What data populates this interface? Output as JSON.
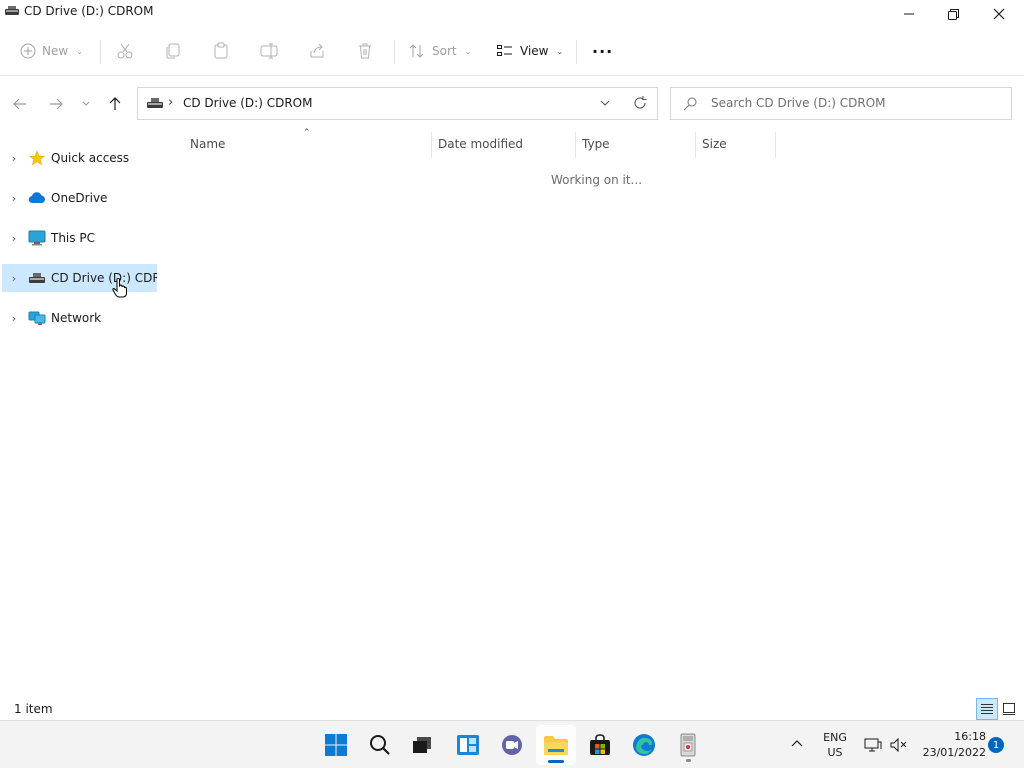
{
  "window": {
    "title": "CD Drive (D:) CDROM"
  },
  "commandbar": {
    "new_label": "New",
    "sort_label": "Sort",
    "view_label": "View",
    "more_label": "···"
  },
  "address": {
    "path": "CD Drive (D:) CDROM",
    "separator": "›"
  },
  "search": {
    "placeholder": "Search CD Drive (D:) CDROM"
  },
  "sidebar": {
    "items": [
      {
        "label": "Quick access",
        "icon": "star-icon"
      },
      {
        "label": "OneDrive",
        "icon": "cloud-icon"
      },
      {
        "label": "This PC",
        "icon": "monitor-icon"
      },
      {
        "label": "CD Drive (D:) CDROM",
        "icon": "cd-drive-icon",
        "selected": true
      },
      {
        "label": "Network",
        "icon": "network-icon"
      }
    ]
  },
  "columns": {
    "name": "Name",
    "date_modified": "Date modified",
    "type": "Type",
    "size": "Size"
  },
  "content": {
    "status_message": "Working on it..."
  },
  "statusbar": {
    "item_count": "1 item"
  },
  "taskbar": {
    "language": "ENG",
    "region": "US",
    "time": "16:18",
    "date": "23/01/2022",
    "notification_count": "1"
  },
  "colors": {
    "accent": "#0067c0",
    "selection": "#cce8ff"
  }
}
